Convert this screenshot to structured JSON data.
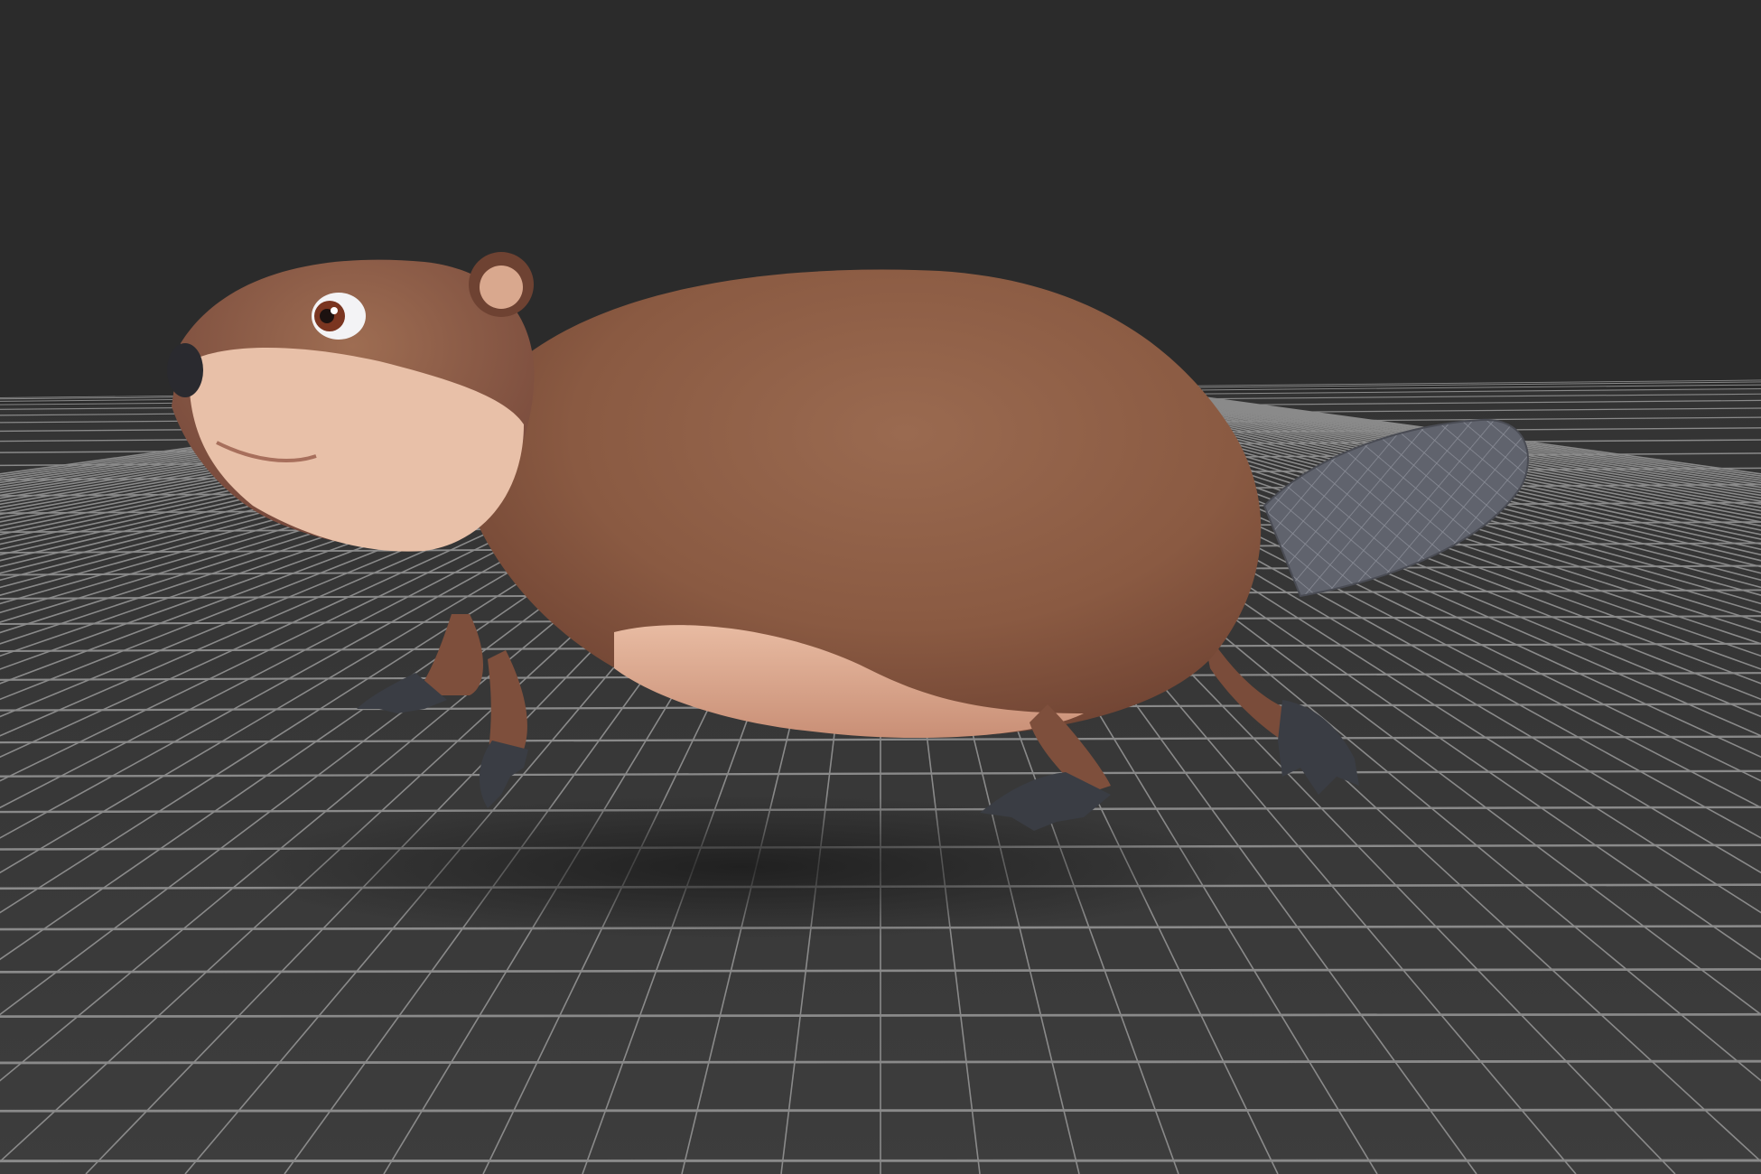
{
  "viewport": {
    "type": "3d-model-preview",
    "model": "beaver",
    "background_color": "#2b2b2b",
    "floor": "grid",
    "grid_color": "#8a8a8a",
    "floor_color": "#3a3a3a"
  },
  "colors": {
    "fur": "#8a5a42",
    "belly": "#e6b49c",
    "tail": "#5b5e68",
    "claws": "#3a3d44",
    "eye_iris": "#7a3520"
  },
  "icons": [
    "beaver-model",
    "floor-grid"
  ]
}
